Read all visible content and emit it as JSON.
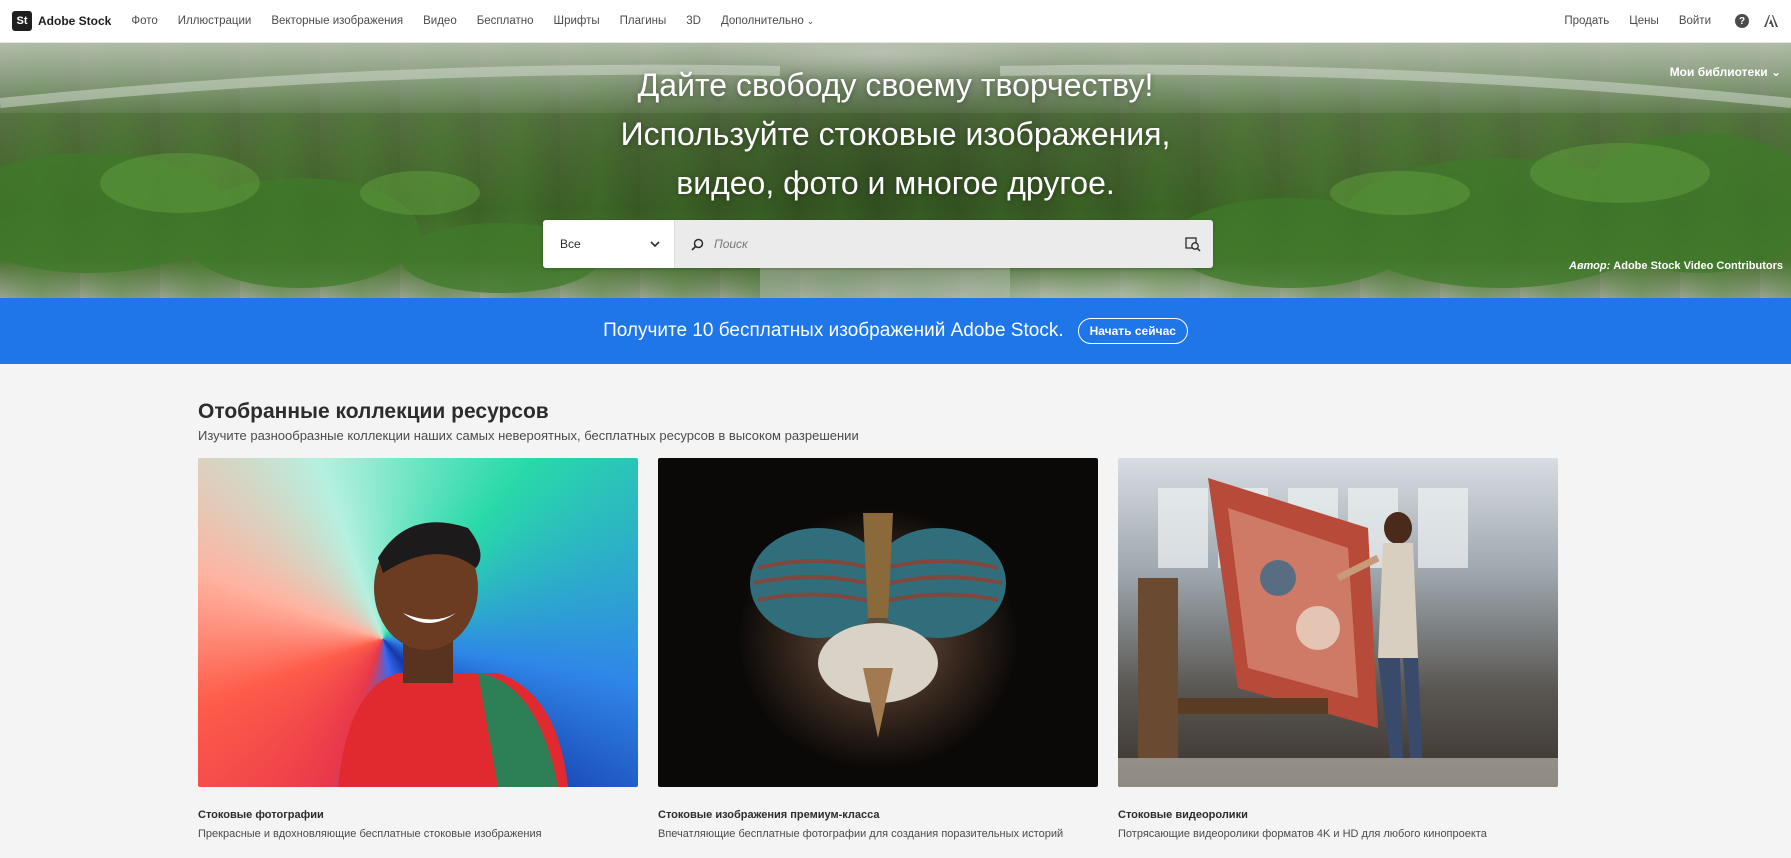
{
  "nav": {
    "logo_mark": "St",
    "brand": "Adobe Stock",
    "items": [
      "Фото",
      "Иллюстрации",
      "Векторные изображения",
      "Видео",
      "Бесплатно",
      "Шрифты",
      "Плагины",
      "3D"
    ],
    "more": "Дополнительно",
    "sell": "Продать",
    "pricing": "Цены",
    "login": "Войти",
    "help_glyph": "?"
  },
  "hero": {
    "line1": "Дайте свободу своему творчеству!",
    "line2": "Используйте стоковые изображения,",
    "line3": "видео, фото и многое другое.",
    "libraries": "Мои библиотеки",
    "credit_prefix": "Автор:",
    "credit_name": "Adobe Stock Video Contributors"
  },
  "search": {
    "category": "Все",
    "placeholder": "Поиск"
  },
  "promo": {
    "text": "Получите 10 бесплатных изображений Adobe Stock.",
    "button": "Начать сейчас"
  },
  "collections": {
    "title": "Отобранные коллекции ресурсов",
    "subtitle": "Изучите разнообразные коллекции наших самых невероятных, бесплатных ресурсов в высоком разрешении",
    "cards": [
      {
        "title": "Стоковые фотографии",
        "desc": "Прекрасные и вдохновляющие бесплатные стоковые изображения"
      },
      {
        "title": "Стоковые изображения премиум-класса",
        "desc": "Впечатляющие бесплатные фотографии для создания поразительных историй"
      },
      {
        "title": "Стоковые видеоролики",
        "desc": "Потрясающие видеоролики форматов 4K и HD для любого кинопроекта"
      }
    ]
  },
  "colors": {
    "promo_blue": "#1e76e8",
    "page_bg": "#f4f4f4"
  }
}
